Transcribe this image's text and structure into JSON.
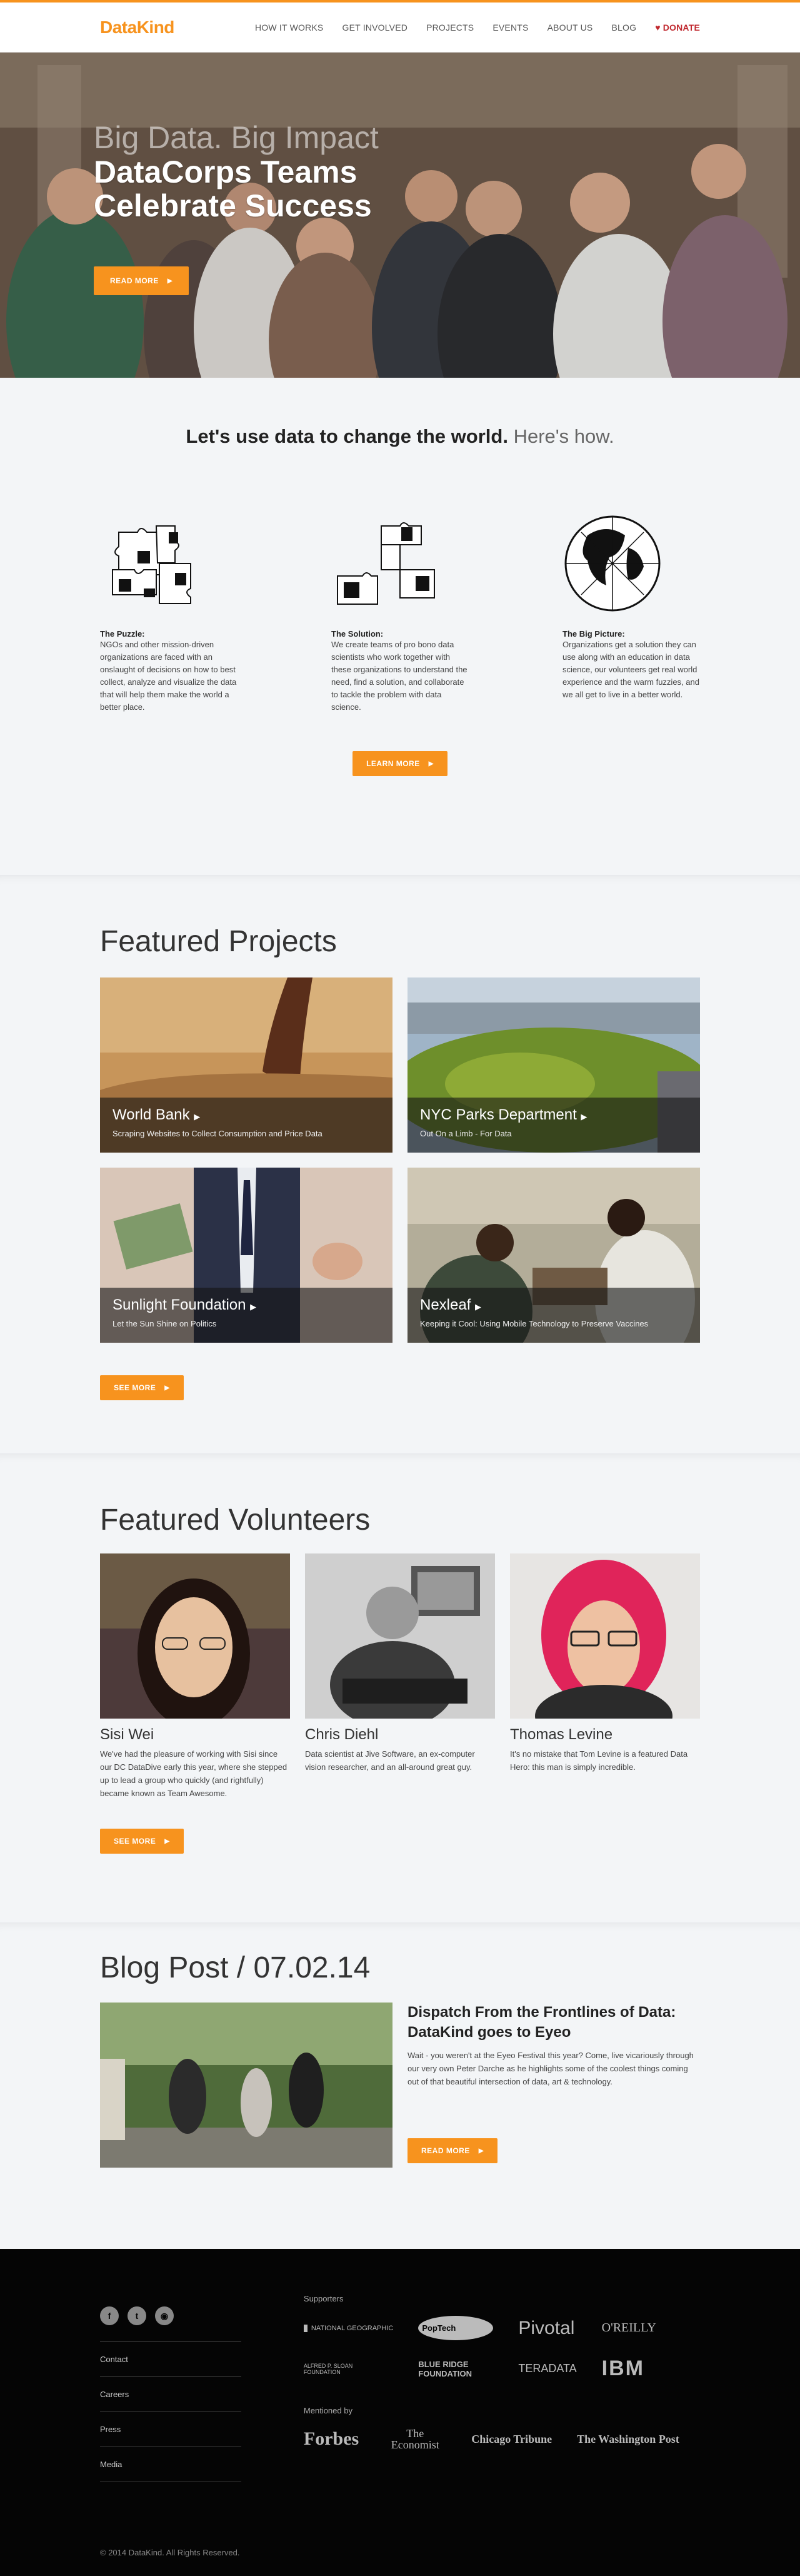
{
  "header": {
    "logo": "DataKind",
    "nav": [
      "HOW IT WORKS",
      "GET INVOLVED",
      "PROJECTS",
      "EVENTS",
      "ABOUT US",
      "BLOG"
    ],
    "donate": "DONATE"
  },
  "hero": {
    "subtitle": "Big Data. Big Impact",
    "title": "DataCorps Teams Celebrate Success",
    "button": "READ MORE"
  },
  "how": {
    "headline_bold": "Let's use data to change the world.",
    "headline_light": "Here's how.",
    "columns": [
      {
        "title": "The Puzzle:",
        "text": "NGOs and other mission-driven organizations are faced with an onslaught of decisions on how to best collect, analyze and visualize the data that will help them make the world a better place."
      },
      {
        "title": "The Solution:",
        "text": "We create teams of pro bono data scientists who work together with these organizations to understand the need, find a solution, and collaborate to tackle the problem with data science."
      },
      {
        "title": "The Big Picture:",
        "text": "Organizations get a solution they can use along with an education in data science, our volunteers get real world experience and the warm fuzzies, and we all get to live in a better world."
      }
    ],
    "button": "LEARN MORE"
  },
  "projects": {
    "title": "Featured Projects",
    "items": [
      {
        "name": "World Bank",
        "desc": "Scraping Websites to Collect Consumption and Price Data"
      },
      {
        "name": "NYC Parks Department",
        "desc": "Out On a Limb - For Data"
      },
      {
        "name": "Sunlight Foundation",
        "desc": "Let the Sun Shine on Politics"
      },
      {
        "name": "Nexleaf",
        "desc": "Keeping it Cool: Using Mobile Technology to Preserve Vaccines"
      }
    ],
    "button": "SEE MORE"
  },
  "volunteers": {
    "title": "Featured Volunteers",
    "items": [
      {
        "name": "Sisi Wei",
        "desc": "We've had the pleasure of working with Sisi since our DC DataDive early this year, where she stepped up to lead a group who quickly (and rightfully) became known as Team Awesome."
      },
      {
        "name": "Chris Diehl",
        "desc": "Data scientist at Jive Software, an ex-computer vision researcher, and an all-around great guy."
      },
      {
        "name": "Thomas Levine",
        "desc": "It's no mistake that Tom Levine is a featured Data Hero: this man is simply incredible."
      }
    ],
    "button": "SEE MORE"
  },
  "blog": {
    "title": "Blog Post / 07.02.14",
    "post_title": "Dispatch From the Frontlines of Data: DataKind goes to Eyeo",
    "post_text": "Wait - you weren't at the Eyeo Festival this year?  Come, live vicariously through our very own Peter Darche as he highlights some of the coolest things coming out of that beautiful intersection of data, art & technology.",
    "button": "READ MORE"
  },
  "footer": {
    "links": [
      "Contact",
      "Careers",
      "Press",
      "Media"
    ],
    "supporters_label": "Supporters",
    "supporters": [
      "NATIONAL GEOGRAPHIC",
      "PopTech",
      "Pivotal",
      "O'REILLY",
      "ALFRED P. SLOAN FOUNDATION",
      "BLUE RIDGE FOUNDATION",
      "TERADATA",
      "IBM"
    ],
    "mentioned_label": "Mentioned by",
    "press": [
      "Forbes",
      "The Economist",
      "Chicago Tribune",
      "The Washington Post"
    ],
    "copyright": "© 2014 DataKind. All Rights Reserved."
  },
  "colors": {
    "accent": "#f7931e",
    "footer": "#050505",
    "donate": "#c0272d"
  }
}
